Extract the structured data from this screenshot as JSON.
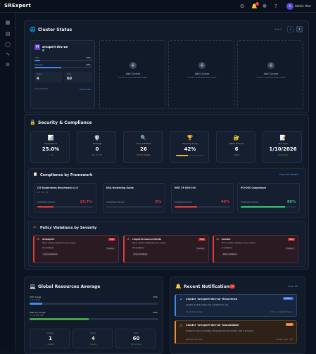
{
  "app": {
    "brand": "SRExpert",
    "user": "Admin User",
    "avatar": "A",
    "notif_count": "1"
  },
  "topbar_icons": [
    "gear-icon",
    "bell-icon",
    "settings-icon",
    "help-icon"
  ],
  "sidebar": [
    "grid-icon",
    "server-icon",
    "shield-icon",
    "activity-icon",
    "settings-icon"
  ],
  "cluster_status": {
    "title": "Cluster Status",
    "pager": "1 of 1",
    "cluster": {
      "name": "srexpert-dev-ue",
      "cpu_label": "CPU",
      "cpu_value": "10%",
      "cpu": 0.1,
      "memory_label": "Memory",
      "memory_value": "46%",
      "memory": 0.46,
      "nodes_label": "Nodes",
      "nodes": "4",
      "pods_label": "Pods",
      "pods": "60",
      "provider_label": "Cloud Provider",
      "provider": "Kubernetes"
    },
    "add_label": "Add Cluster",
    "add_sub": "Connect a new Kubernetes cluster"
  },
  "security": {
    "title": "Security & Compliance",
    "stats": [
      {
        "label": "Compliance",
        "value": "25.0%",
        "sub": "↑ +3",
        "icon": "📊",
        "sub_color": "#43a047"
      },
      {
        "label": "Findings",
        "value": "0",
        "sub": "26 · H · (5)",
        "icon": "🛡️",
        "sub_color": "#8895a8"
      },
      {
        "label": "Vulnerabilities",
        "value": "26",
        "sub": "0 Scan Images",
        "icon": "🔍",
        "sub_color": "#f0a030"
      },
      {
        "label": "Security Score",
        "value": "42%",
        "sub": "",
        "icon": "🏆",
        "sub_color": "#8895a8",
        "bar": 0.42
      },
      {
        "label": "RBAC Policies",
        "value": "6",
        "sub": "Active",
        "icon": "🔐",
        "sub_color": "#8895a8"
      },
      {
        "label": "Last Scan",
        "value": "1/10/2026",
        "sub": "Completed",
        "icon": "📝",
        "sub_color": "#43a047"
      }
    ]
  },
  "frameworks": {
    "title": "Compliance by Framework",
    "link": "View full details",
    "items": [
      {
        "name": "CIS Kubernetes Benchmark v1.8",
        "sub": "11 · 15 · 15",
        "score_label": "Compliance Score",
        "score": "29.7%",
        "value": 0.297,
        "color": "#e53935"
      },
      {
        "name": "NSA Hardening Guide",
        "sub": "",
        "score_label": "Compliance Score",
        "score": "0%",
        "value": 0.0,
        "color": "#e53935"
      },
      {
        "name": "NIST SP 800-190",
        "sub": "",
        "score_label": "Compliance Score",
        "score": "40%",
        "value": 0.4,
        "color": "#e53935"
      },
      {
        "name": "PCI-DSS Compliance",
        "sub": "",
        "score_label": "Compliance Score",
        "score": "80%",
        "value": 0.8,
        "color": "#2ecc71"
      }
    ]
  },
  "violations": {
    "title": "Policy Violations by Severity",
    "items": [
      {
        "name": "allowpriv",
        "badge": "HIGH",
        "desc": "Policy violation detected across clusters",
        "count": "26 violations",
        "tag": "Clusters",
        "chip": "Policy Violations"
      },
      {
        "name": "requireresourcelimits",
        "badge": "HIGH",
        "desc": "Policy violation detected across clusters",
        "count": "26 violations",
        "tag": "Clusters",
        "chip": "Policy Violations"
      },
      {
        "name": "blockk",
        "badge": "HIGH",
        "desc": "Policy violation detected across clusters",
        "count": "2 violations",
        "tag": "Clusters",
        "chip": "Policy Violations"
      }
    ]
  },
  "resources": {
    "title": "Global Resources Average",
    "cpu_label": "CPU Usage",
    "cpu_value": "10%",
    "cpu": 0.1,
    "cpu_sub": "1 of 4 cores",
    "mem_label": "Memory Usage",
    "mem_value": "46%",
    "mem": 0.46,
    "mem_sub": "7.5 of 15.6 GiB",
    "counts": [
      {
        "label": "Clusters",
        "value": "1",
        "sub": "1 healthy"
      },
      {
        "label": "Nodes",
        "value": "4",
        "sub": "4 ready"
      },
      {
        "label": "Pods",
        "value": "60",
        "sub": "60 running"
      }
    ]
  },
  "notifications": {
    "title": "Recent Notifications",
    "count": "10",
    "link": "View All",
    "items": [
      {
        "title": "Cluster 'srexpert-dev-ue' Recovered",
        "badge": "GENERAL",
        "text": "Cluster is back online and available for use.",
        "time": "about 2 hours ago",
        "meta": "1 hour · srexpert-dev-ue",
        "kind": "info"
      },
      {
        "title": "Cluster 'srexpert-dev-ue' Unavailable",
        "badge": "ALERT",
        "text": "Cluster is now unavailable. Requests will be blocked until it recovers.",
        "time": "about 2 hours ago",
        "meta": "Cluster down · 2/3",
        "kind": "warn"
      }
    ]
  }
}
